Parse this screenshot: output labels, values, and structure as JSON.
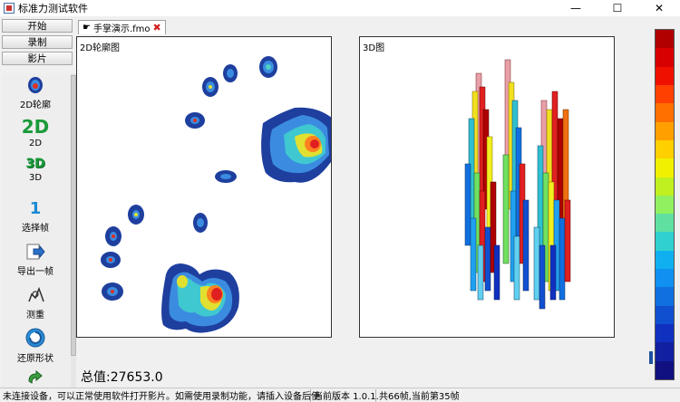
{
  "window": {
    "title": "标准力测试软件",
    "controls": {
      "minimize": "—",
      "maximize": "☐",
      "close": "✕"
    }
  },
  "nav": {
    "buttons": [
      "开始",
      "录制",
      "影片"
    ]
  },
  "tools": [
    {
      "label": "2D轮廓",
      "icon": "foot-contour-icon"
    },
    {
      "label": "2D",
      "icon_text": "2D"
    },
    {
      "label": "3D",
      "icon_text": "3D"
    },
    {
      "label": "选择帧",
      "icon_text": "1"
    },
    {
      "label": "导出一帧",
      "icon": "export-frame-icon"
    },
    {
      "label": "测重",
      "icon": "weigh-icon"
    },
    {
      "label": "还原形状",
      "icon": "restore-shape-icon"
    }
  ],
  "tab": {
    "label": "手掌演示.fmo",
    "close": "✖"
  },
  "panels": {
    "left_title": "2D轮廓图",
    "right_title": "3D图"
  },
  "total": "总值:27653.0",
  "status": {
    "message": "未连接设备，可以正常使用软件打开影片。如需使用录制功能，请插入设备后使",
    "version": "当前版本 1.0.1.",
    "frames": "共66帧,当前第35帧"
  },
  "colors": {
    "scale": [
      "#b00000",
      "#d80000",
      "#f01000",
      "#ff4000",
      "#ff7000",
      "#ffa000",
      "#ffd000",
      "#f0f000",
      "#c0f020",
      "#90f060",
      "#60e0a0",
      "#30d0d0",
      "#10b0f0",
      "#1090f0",
      "#1070e0",
      "#1050d0",
      "#1030c0",
      "#1020a0",
      "#101080"
    ]
  }
}
